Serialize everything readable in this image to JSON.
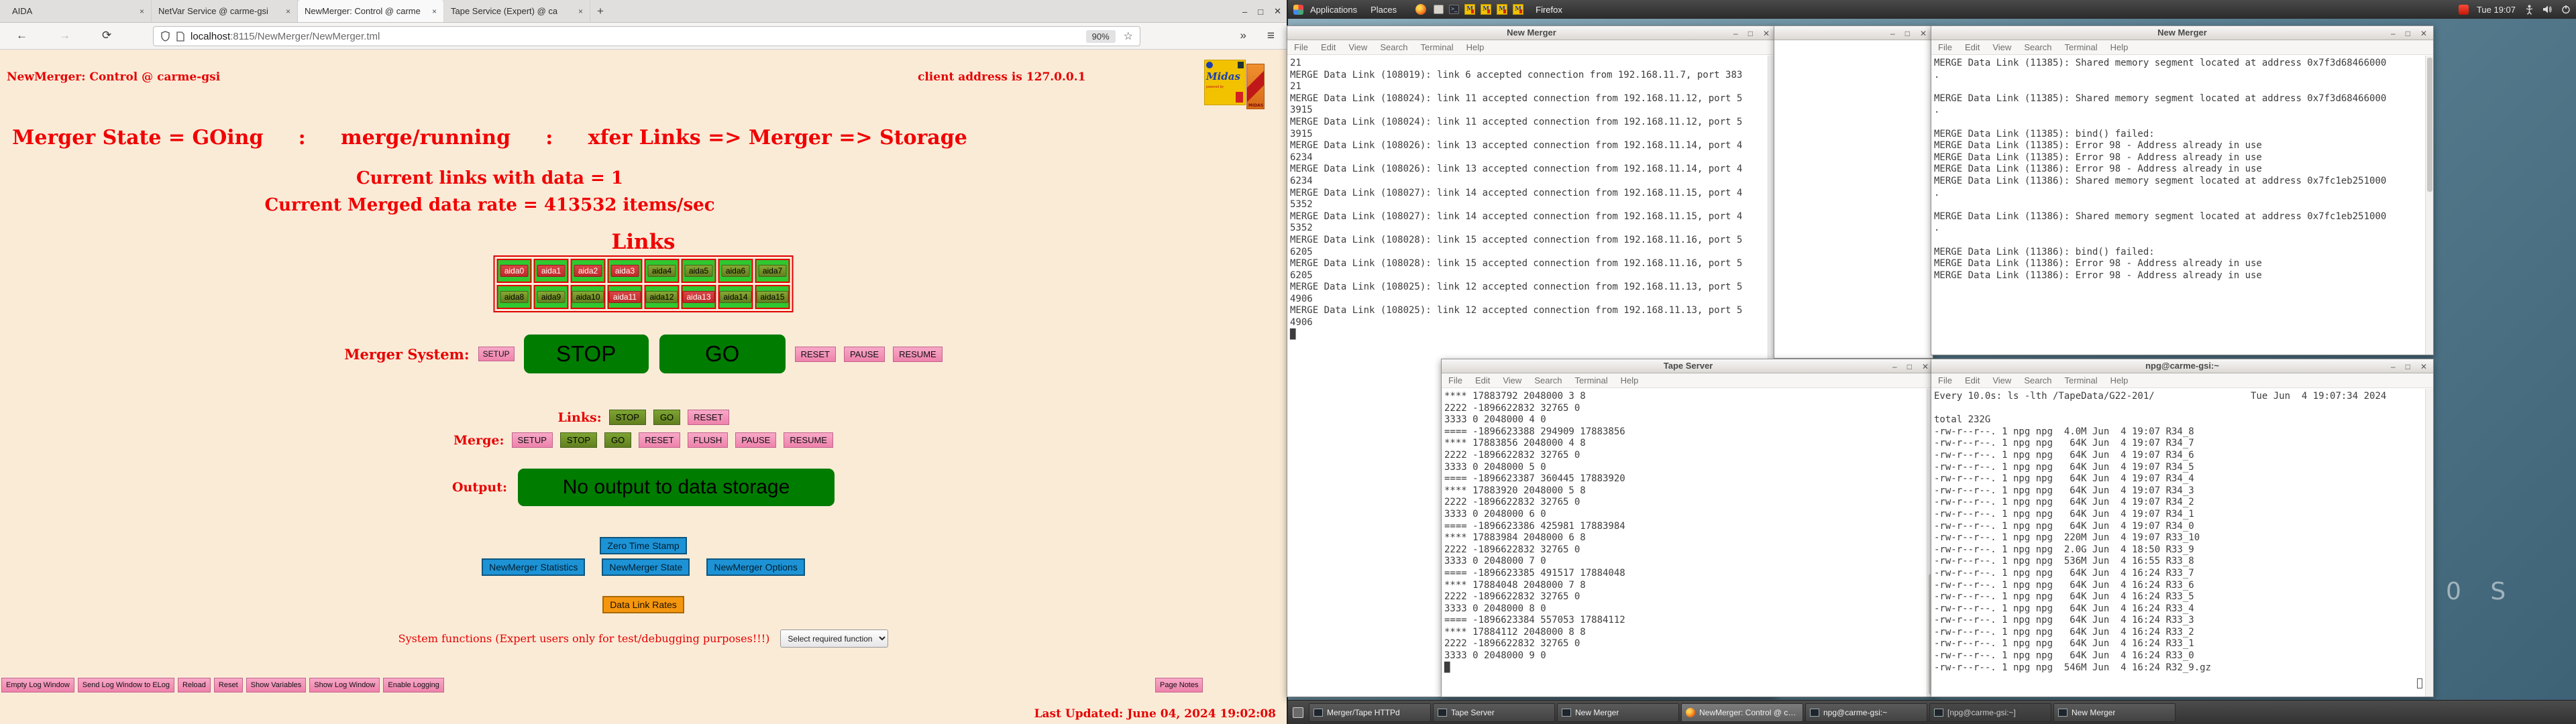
{
  "browser": {
    "tabs": [
      {
        "label": "AIDA",
        "close": "×",
        "state": "inactive"
      },
      {
        "label": "NetVar Service @ carme-gsi",
        "close": "×",
        "state": "inactive"
      },
      {
        "label": "NewMerger: Control @ carme",
        "close": "×",
        "state": "active"
      },
      {
        "label": "Tape Service (Expert) @ ca",
        "close": "×",
        "state": "inactive"
      }
    ],
    "new_tab_button": "+",
    "window_controls": {
      "minimize": "–",
      "maximize": "□",
      "close": "✕"
    },
    "nav": {
      "back": "←",
      "forward": "→",
      "reload": "⟳",
      "overflow": "»",
      "menu": "≡",
      "star": "☆"
    },
    "url": {
      "host": "localhost",
      "rest": ":8115/NewMerger/NewMerger.tml",
      "zoom": "90%"
    }
  },
  "page": {
    "title": "NewMerger: Control @ carme-gsi",
    "client_address": "client address is 127.0.0.1",
    "logo": {
      "brand": "Midas",
      "sub": "powered by",
      "side": "MIDAS"
    },
    "state_line": "Merger State = GOing     :     merge/running     :     xfer Links => Merger => Storage",
    "links_with_data": "Current links with data = 1",
    "data_rate": "Current Merged data rate = 413532 items/sec",
    "links_title": "Links",
    "links": [
      {
        "label": "aida0",
        "state": "red"
      },
      {
        "label": "aida1",
        "state": "red"
      },
      {
        "label": "aida2",
        "state": "red"
      },
      {
        "label": "aida3",
        "state": "red"
      },
      {
        "label": "aida4",
        "state": "green"
      },
      {
        "label": "aida5",
        "state": "green"
      },
      {
        "label": "aida6",
        "state": "green"
      },
      {
        "label": "aida7",
        "state": "green"
      },
      {
        "label": "aida8",
        "state": "green"
      },
      {
        "label": "aida9",
        "state": "green"
      },
      {
        "label": "aida10",
        "state": "green"
      },
      {
        "label": "aida11",
        "state": "red"
      },
      {
        "label": "aida12",
        "state": "green"
      },
      {
        "label": "aida13",
        "state": "red"
      },
      {
        "label": "aida14",
        "state": "green"
      },
      {
        "label": "aida15",
        "state": "green"
      }
    ],
    "merger_system": {
      "label": "Merger System:",
      "setup": "SETUP",
      "stop": "STOP",
      "go": "GO",
      "reset": "RESET",
      "pause": "PAUSE",
      "resume": "RESUME"
    },
    "links_row": {
      "label": "Links:",
      "buttons": [
        {
          "label": "STOP",
          "style": "sgreen"
        },
        {
          "label": "GO",
          "style": "sgreen"
        },
        {
          "label": "RESET",
          "style": "pink"
        }
      ]
    },
    "merge_row": {
      "label": "Merge:",
      "buttons": [
        {
          "label": "SETUP",
          "style": "pink"
        },
        {
          "label": "STOP",
          "style": "sgreen"
        },
        {
          "label": "GO",
          "style": "sgreen"
        },
        {
          "label": "RESET",
          "style": "pink"
        },
        {
          "label": "FLUSH",
          "style": "pink"
        },
        {
          "label": "PAUSE",
          "style": "pink"
        },
        {
          "label": "RESUME",
          "style": "pink"
        }
      ]
    },
    "output": {
      "label": "Output:",
      "button": "No output to data storage"
    },
    "tools": {
      "zero": "Zero Time Stamp",
      "stats": "NewMerger Statistics",
      "state": "NewMerger State",
      "options": "NewMerger Options",
      "rates": "Data Link Rates"
    },
    "system_functions": {
      "label": "System functions (Expert users only for test/debugging purposes!!!)",
      "select": "Select required function"
    },
    "footer_buttons": [
      {
        "label": "Empty Log Window"
      },
      {
        "label": "Send Log Window to ELog"
      },
      {
        "label": "Reload"
      },
      {
        "label": "Reset"
      },
      {
        "label": "Show Variables"
      },
      {
        "label": "Show Log Window"
      },
      {
        "label": "Enable Logging"
      }
    ],
    "page_notes": "Page Notes",
    "last_updated": "Last Updated: June 04, 2024 19:02:08"
  },
  "desktop": {
    "panel": {
      "applications": "Applications",
      "places": "Places",
      "app_label": "Firefox",
      "clock": "Tue 19:07",
      "midas_icons": [
        "M",
        "M",
        "M",
        "M"
      ]
    },
    "window_controls": {
      "minimize": "–",
      "maximize": "□",
      "close": "✕"
    },
    "wallpaper_text": "0 S",
    "windows": [
      {
        "title": "New Merger",
        "menu": [
          "File",
          "Edit",
          "View",
          "Search",
          "Terminal",
          "Help"
        ],
        "lines": [
          "21",
          "MERGE Data Link (108019): link 6 accepted connection from 192.168.11.7, port 383",
          "21",
          "MERGE Data Link (108024): link 11 accepted connection from 192.168.11.12, port 5",
          "3915",
          "MERGE Data Link (108024): link 11 accepted connection from 192.168.11.12, port 5",
          "3915",
          "MERGE Data Link (108026): link 13 accepted connection from 192.168.11.14, port 4",
          "6234",
          "MERGE Data Link (108026): link 13 accepted connection from 192.168.11.14, port 4",
          "6234",
          "MERGE Data Link (108027): link 14 accepted connection from 192.168.11.15, port 4",
          "5352",
          "MERGE Data Link (108027): link 14 accepted connection from 192.168.11.15, port 4",
          "5352",
          "MERGE Data Link (108028): link 15 accepted connection from 192.168.11.16, port 5",
          "6205",
          "MERGE Data Link (108028): link 15 accepted connection from 192.168.11.16, port 5",
          "6205",
          "MERGE Data Link (108025): link 12 accepted connection from 192.168.11.13, port 5",
          "4906",
          "MERGE Data Link (108025): link 12 accepted connection from 192.168.11.13, port 5",
          "4906",
          "█"
        ]
      },
      {
        "title": "",
        "menu": [],
        "lines": []
      },
      {
        "title": "New Merger",
        "menu": [
          "File",
          "Edit",
          "View",
          "Search",
          "Terminal",
          "Help"
        ],
        "lines": [
          "MERGE Data Link (11385): Shared memory segment located at address 0x7f3d68466000",
          ".",
          "",
          "MERGE Data Link (11385): Shared memory segment located at address 0x7f3d68466000",
          ".",
          "",
          "MERGE Data Link (11385): bind() failed:",
          "MERGE Data Link (11385): Error 98 - Address already in use",
          "MERGE Data Link (11385): Error 98 - Address already in use",
          "MERGE Data Link (11386): Error 98 - Address already in use",
          "MERGE Data Link (11386): Shared memory segment located at address 0x7fc1eb251000",
          ".",
          "",
          "MERGE Data Link (11386): Shared memory segment located at address 0x7fc1eb251000",
          ".",
          "",
          "MERGE Data Link (11386): bind() failed:",
          "MERGE Data Link (11386): Error 98 - Address already in use",
          "MERGE Data Link (11386): Error 98 - Address already in use"
        ]
      },
      {
        "title": "Tape Server",
        "menu": [
          "File",
          "Edit",
          "View",
          "Search",
          "Terminal",
          "Help"
        ],
        "lines": [
          "**** 17883792 2048000 3 8",
          "2222 -1896622832 32765 0",
          "3333 0 2048000 4 0",
          "==== -1896623388 294909 17883856",
          "**** 17883856 2048000 4 8",
          "2222 -1896622832 32765 0",
          "3333 0 2048000 5 0",
          "==== -1896623387 360445 17883920",
          "**** 17883920 2048000 5 8",
          "2222 -1896622832 32765 0",
          "3333 0 2048000 6 0",
          "==== -1896623386 425981 17883984",
          "**** 17883984 2048000 6 8",
          "2222 -1896622832 32765 0",
          "3333 0 2048000 7 0",
          "==== -1896623385 491517 17884048",
          "**** 17884048 2048000 7 8",
          "2222 -1896622832 32765 0",
          "3333 0 2048000 8 0",
          "==== -1896623384 557053 17884112",
          "**** 17884112 2048000 8 8",
          "2222 -1896622832 32765 0",
          "3333 0 2048000 9 0",
          "█"
        ]
      },
      {
        "title": "npg@carme-gsi:~",
        "menu": [
          "File",
          "Edit",
          "View",
          "Search",
          "Terminal",
          "Help"
        ],
        "lines": [
          "Every 10.0s: ls -lth /TapeData/G22-201/                 Tue Jun  4 19:07:34 2024",
          "",
          "total 232G",
          "-rw-r--r--. 1 npg npg  4.0M Jun  4 19:07 R34_8",
          "-rw-r--r--. 1 npg npg   64K Jun  4 19:07 R34_7",
          "-rw-r--r--. 1 npg npg   64K Jun  4 19:07 R34_6",
          "-rw-r--r--. 1 npg npg   64K Jun  4 19:07 R34_5",
          "-rw-r--r--. 1 npg npg   64K Jun  4 19:07 R34_4",
          "-rw-r--r--. 1 npg npg   64K Jun  4 19:07 R34_3",
          "-rw-r--r--. 1 npg npg   64K Jun  4 19:07 R34_2",
          "-rw-r--r--. 1 npg npg   64K Jun  4 19:07 R34_1",
          "-rw-r--r--. 1 npg npg   64K Jun  4 19:07 R34_0",
          "-rw-r--r--. 1 npg npg  220M Jun  4 19:07 R33_10",
          "-rw-r--r--. 1 npg npg  2.0G Jun  4 18:50 R33_9",
          "-rw-r--r--. 1 npg npg  536M Jun  4 16:55 R33_8",
          "-rw-r--r--. 1 npg npg   64K Jun  4 16:24 R33_7",
          "-rw-r--r--. 1 npg npg   64K Jun  4 16:24 R33_6",
          "-rw-r--r--. 1 npg npg   64K Jun  4 16:24 R33_5",
          "-rw-r--r--. 1 npg npg   64K Jun  4 16:24 R33_4",
          "-rw-r--r--. 1 npg npg   64K Jun  4 16:24 R33_3",
          "-rw-r--r--. 1 npg npg   64K Jun  4 16:24 R33_2",
          "-rw-r--r--. 1 npg npg   64K Jun  4 16:24 R33_1",
          "-rw-r--r--. 1 npg npg   64K Jun  4 16:24 R33_0",
          "-rw-r--r--. 1 npg npg  546M Jun  4 16:24 R32_9.gz"
        ]
      }
    ],
    "taskbar": {
      "buttons": [
        {
          "label": "Merger/Tape HTTPd",
          "icon": "terminal",
          "state": "normal"
        },
        {
          "label": "Tape Server",
          "icon": "terminal",
          "state": "normal"
        },
        {
          "label": "New Merger",
          "icon": "terminal",
          "state": "normal"
        },
        {
          "label": "NewMerger: Control @ car...",
          "icon": "firefox",
          "state": "active"
        },
        {
          "label": "npg@carme-gsi:~",
          "icon": "terminal",
          "state": "normal"
        },
        {
          "label": "[npg@carme-gsi:~]",
          "icon": "terminal",
          "state": "min"
        },
        {
          "label": "New Merger",
          "icon": "terminal",
          "state": "normal"
        }
      ]
    }
  }
}
